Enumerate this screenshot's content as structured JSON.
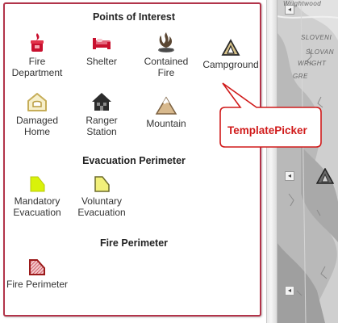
{
  "map": {
    "text_top": "Wrightwood",
    "text_1": "SLOVENI",
    "text_2": "SLOVAN",
    "text_3": "WRIGHT",
    "text_4": "GRE"
  },
  "picker": {
    "sections": [
      {
        "title": "Points of Interest",
        "items": [
          {
            "label": "Fire Department",
            "icon": "fire-department-icon"
          },
          {
            "label": "Shelter",
            "icon": "shelter-icon"
          },
          {
            "label": "Contained Fire",
            "icon": "contained-fire-icon"
          },
          {
            "label": "Campground",
            "icon": "campground-icon"
          },
          {
            "label": "Damaged Home",
            "icon": "damaged-home-icon"
          },
          {
            "label": "Ranger Station",
            "icon": "ranger-station-icon"
          },
          {
            "label": "Mountain",
            "icon": "mountain-icon"
          }
        ]
      },
      {
        "title": "Evacuation Perimeter",
        "items": [
          {
            "label": "Mandatory Evacuation",
            "icon": "mandatory-evacuation-icon",
            "color": "#d9f20a"
          },
          {
            "label": "Voluntary Evacuation",
            "icon": "voluntary-evacuation-icon",
            "color": "#f2f07a"
          }
        ]
      },
      {
        "title": "Fire Perimeter",
        "items": [
          {
            "label": "Fire Perimeter",
            "icon": "fire-perimeter-icon",
            "color": "#b22a2a"
          }
        ]
      }
    ]
  },
  "callout": {
    "label": "TemplatePicker"
  }
}
